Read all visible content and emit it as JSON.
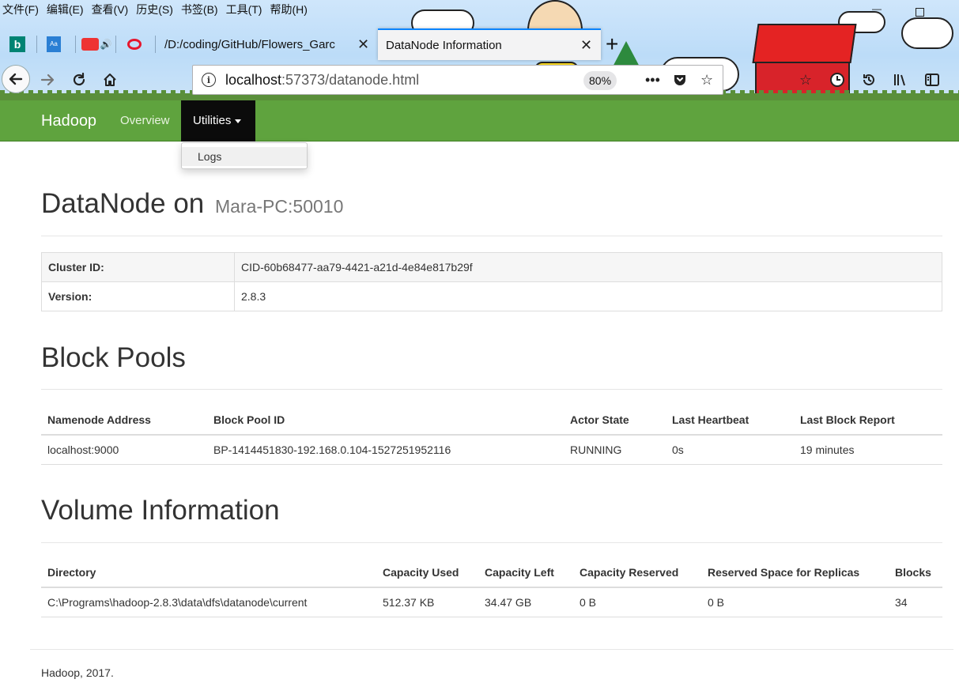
{
  "browser": {
    "menu": [
      "文件(F)",
      "编辑(E)",
      "查看(V)",
      "历史(S)",
      "书签(B)",
      "工具(T)",
      "帮助(H)"
    ],
    "tabs": [
      {
        "title": "/D:/coding/GitHub/Flowers_Garc",
        "active": false
      },
      {
        "title": "DataNode Information",
        "active": true
      }
    ],
    "url_host": "localhost",
    "url_rest": ":57373/datanode.html",
    "zoom": "80%",
    "accent": "#0a84ff"
  },
  "hadoop_nav": {
    "brand": "Hadoop",
    "overview": "Overview",
    "utilities": "Utilities",
    "dropdown_items": [
      "Logs"
    ],
    "bar_color": "#5fa33e"
  },
  "page": {
    "title": "DataNode on",
    "title_host": "Mara-PC:50010",
    "info": [
      {
        "key": "Cluster ID:",
        "value": "CID-60b68477-aa79-4421-a21d-4e84e817b29f"
      },
      {
        "key": "Version:",
        "value": "2.8.3"
      }
    ],
    "block_pools": {
      "heading": "Block Pools",
      "columns": [
        "Namenode Address",
        "Block Pool ID",
        "Actor State",
        "Last Heartbeat",
        "Last Block Report"
      ],
      "rows": [
        [
          "localhost:9000",
          "BP-1414451830-192.168.0.104-1527251952116",
          "RUNNING",
          "0s",
          "19 minutes"
        ]
      ]
    },
    "volume": {
      "heading": "Volume Information",
      "columns": [
        "Directory",
        "Capacity Used",
        "Capacity Left",
        "Capacity Reserved",
        "Reserved Space for Replicas",
        "Blocks"
      ],
      "rows": [
        [
          "C:\\Programs\\hadoop-2.8.3\\data\\dfs\\datanode\\current",
          "512.37 KB",
          "34.47 GB",
          "0 B",
          "0 B",
          "34"
        ]
      ]
    },
    "footer": "Hadoop, 2017."
  }
}
